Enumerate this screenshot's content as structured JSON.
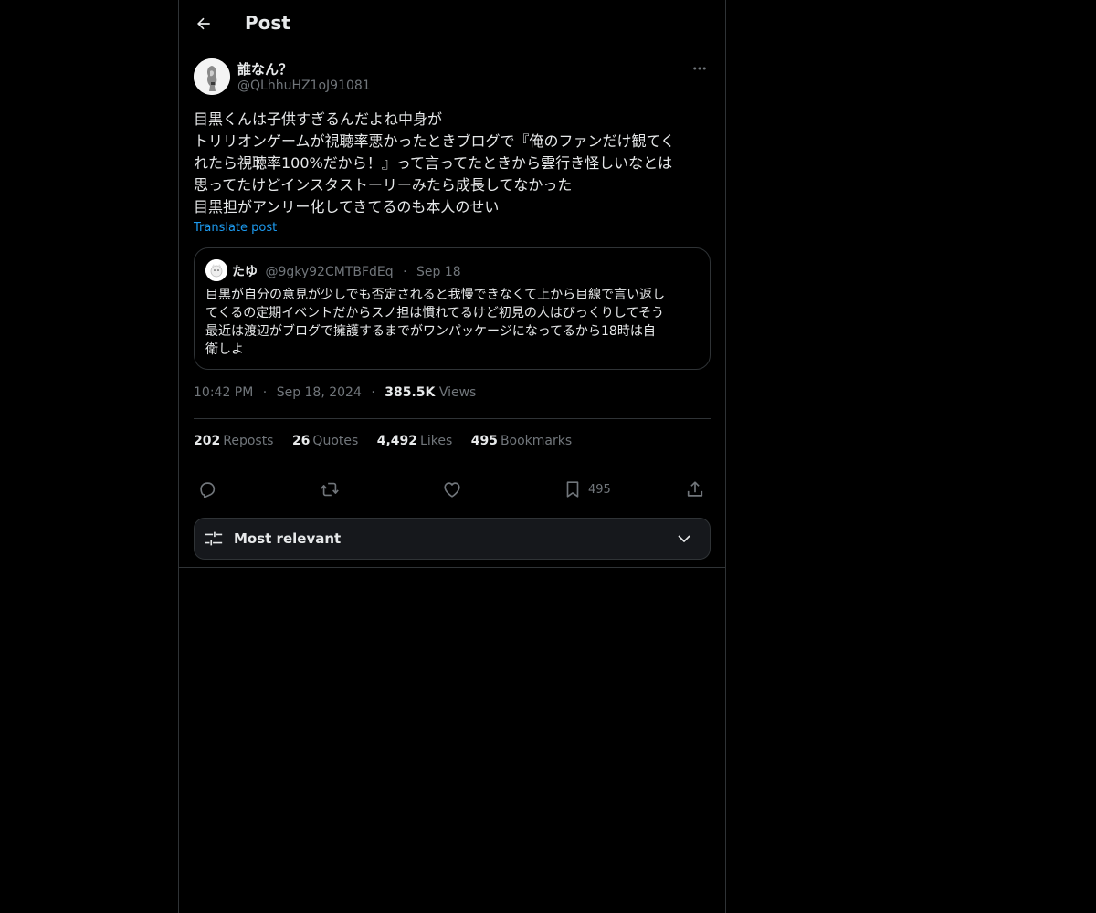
{
  "header": {
    "title": "Post",
    "back_icon": "arrow-left-icon"
  },
  "author": {
    "name": "誰なん？",
    "handle": "@QLhhuHZ1oJ91081",
    "more_icon": "ellipsis-icon"
  },
  "post": {
    "lines": [
      "目黒くんは子供すぎるんだよね中身が",
      "トリリオンゲームが視聴率悪かったときブログで『俺のファンだけ観てく",
      "れたら視聴率100%だから！』って言ってたときから雲行き怪しいなとは",
      "思ってたけどインスタストーリーみたら成長してなかった",
      "目黒担がアンリー化してきてるのも本人のせい"
    ],
    "translate_label": "Translate post"
  },
  "quote": {
    "name": "たゆ",
    "handle": "@9gky92CMTBFdEq",
    "separator": "·",
    "date": "Sep 18",
    "lines": [
      "目黒が自分の意見が少しでも否定されると我慢できなくて上から目線で言い返し",
      "てくるの定期イベントだからスノ担は慣れてるけど初見の人はびっくりしてそう",
      "最近は渡辺がブログで擁護するまでがワンパッケージになってるから18時は自",
      "衛しよ"
    ]
  },
  "meta": {
    "time": "10:42 PM",
    "separator": "·",
    "date": "Sep 18, 2024",
    "views_count": "385.5K",
    "views_label": "Views"
  },
  "stats": [
    {
      "count": "202",
      "label": "Reposts"
    },
    {
      "count": "26",
      "label": "Quotes"
    },
    {
      "count": "4,492",
      "label": "Likes"
    },
    {
      "count": "495",
      "label": "Bookmarks"
    }
  ],
  "actions": {
    "reply_icon": "reply-icon",
    "repost_icon": "repost-icon",
    "like_icon": "heart-icon",
    "bookmark_icon": "bookmark-icon",
    "bookmark_count": "495",
    "share_icon": "share-icon"
  },
  "sort": {
    "label": "Most relevant",
    "icon": "sliders-icon",
    "chevron": "chevron-down-icon"
  },
  "colors": {
    "background": "#000000",
    "text": "#e7e9ea",
    "muted": "#71767b",
    "border": "#2f3336",
    "link": "#1d9bf0"
  }
}
